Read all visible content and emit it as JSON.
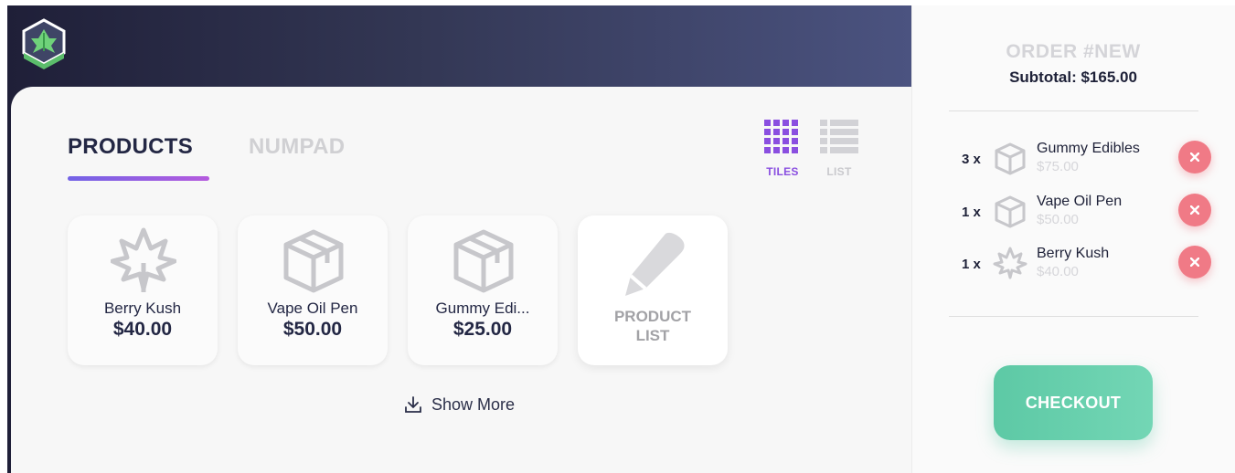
{
  "tabs": {
    "products": "PRODUCTS",
    "numpad": "NUMPAD"
  },
  "view": {
    "tiles": "TILES",
    "list": "LIST",
    "active": "tiles"
  },
  "products": [
    {
      "name": "Berry Kush",
      "price": "$40.00",
      "icon": "cannabis-leaf-icon"
    },
    {
      "name": "Vape Oil Pen",
      "price": "$50.00",
      "icon": "box-icon"
    },
    {
      "name": "Gummy Edi...",
      "price": "$25.00",
      "icon": "box-icon"
    }
  ],
  "product_list_tile": {
    "line1": "PRODUCT",
    "line2": "LIST",
    "icon": "pencil-icon"
  },
  "show_more": "Show More",
  "order": {
    "title": "ORDER #NEW",
    "subtotal": "Subtotal: $165.00",
    "items": [
      {
        "qty": "3 x",
        "name": "Gummy Edibles",
        "price": "$75.00",
        "icon": "box-icon"
      },
      {
        "qty": "1 x",
        "name": "Vape Oil Pen",
        "price": "$50.00",
        "icon": "box-icon"
      },
      {
        "qty": "1 x",
        "name": "Berry Kush",
        "price": "$40.00",
        "icon": "cannabis-leaf-icon"
      }
    ]
  },
  "checkout": "CHECKOUT",
  "colors": {
    "accent_purple": "#8a4fe0",
    "checkout_green": "#5dc9a5",
    "remove_red": "#f07a86",
    "header_dark": "#1f1f38"
  }
}
